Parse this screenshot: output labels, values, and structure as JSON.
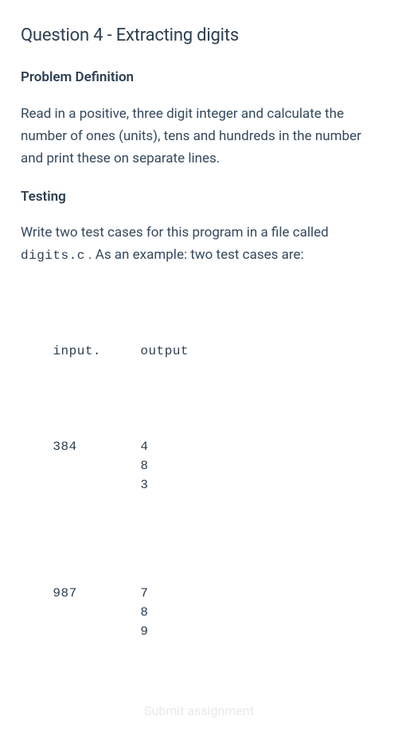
{
  "title": "Question 4 - Extracting digits",
  "sections": {
    "problem": {
      "heading": "Problem Definition",
      "body": "Read in a positive, three digit integer and calculate the number of ones (units), tens and hundreds in the number and print these on separate lines."
    },
    "testing": {
      "heading": "Testing",
      "body_pre": "Write two test cases for this program in a file called ",
      "filename": "digits.c",
      "body_post": " . As an example: two test cases are:"
    }
  },
  "table": {
    "header_input": "input.",
    "header_output": "output",
    "rows": [
      {
        "input": "384",
        "output": "4\n8\n3"
      },
      {
        "input": "987",
        "output": "7\n8\n9"
      }
    ]
  },
  "ghost": "Submit assignment"
}
